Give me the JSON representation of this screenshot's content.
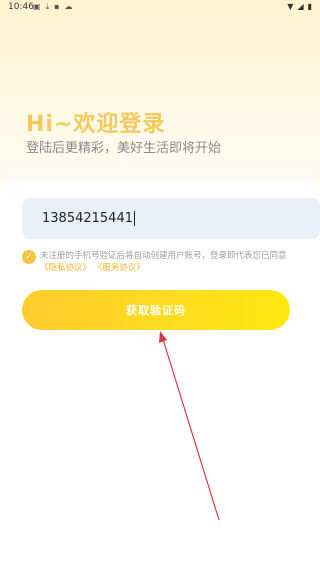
{
  "status_bar": {
    "time": "10:46",
    "left_icons": [
      "image-icon",
      "download-icon",
      "app-icon",
      "cloud-icon"
    ],
    "right_icons": [
      "wifi-icon",
      "signal-icon",
      "battery-icon"
    ]
  },
  "hero": {
    "title": "Hi~欢迎登录",
    "subtitle": "登陆后更精彩，美好生活即将开始"
  },
  "form": {
    "phone_value": "13854215441",
    "agreement_text": "未注册的手机号验证后将自动创建用户账号，登录即代表您已同意",
    "privacy_link": "《隐私协议》",
    "service_link": "《服务协议》",
    "get_code_label": "获取验证码"
  },
  "colors": {
    "accent": "#f7c242",
    "title": "#f4c95a",
    "link": "#f3b52e",
    "annotation_arrow": "#d9393b"
  }
}
